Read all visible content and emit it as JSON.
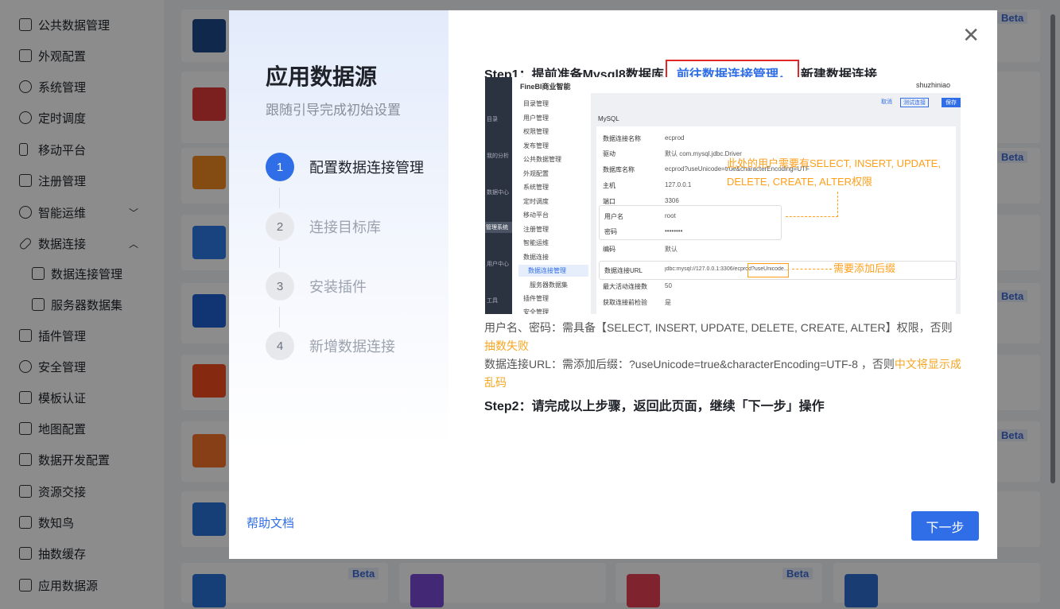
{
  "sidebar": {
    "items": [
      {
        "label": "公共数据管理"
      },
      {
        "label": "外观配置"
      },
      {
        "label": "系统管理"
      },
      {
        "label": "定时调度"
      },
      {
        "label": "移动平台"
      },
      {
        "label": "注册管理"
      },
      {
        "label": "智能运维"
      },
      {
        "label": "数据连接"
      },
      {
        "label": "数据连接管理"
      },
      {
        "label": "服务器数据集"
      },
      {
        "label": "插件管理"
      },
      {
        "label": "安全管理"
      },
      {
        "label": "模板认证"
      },
      {
        "label": "地图配置"
      },
      {
        "label": "数据开发配置"
      },
      {
        "label": "资源交接"
      },
      {
        "label": "数知鸟"
      },
      {
        "label": "抽数缓存"
      },
      {
        "label": "应用数据源"
      }
    ]
  },
  "background": {
    "beta_label": "Beta"
  },
  "modal": {
    "title": "应用数据源",
    "subtitle": "跟随引导完成初始设置",
    "steps": [
      {
        "num": "1",
        "label": "配置数据连接管理"
      },
      {
        "num": "2",
        "label": "连接目标库"
      },
      {
        "num": "3",
        "label": "安装插件"
      },
      {
        "num": "4",
        "label": "新增数据连接"
      }
    ],
    "help_link": "帮助文档",
    "step1_prefix": "Step1：提前准备Mysql8数据库",
    "step1_link": "前往数据连接管理，",
    "step1_suffix": "新建数据连接",
    "screenshot": {
      "app_name": "FineBI商业智能",
      "user": "shuzhiniao",
      "nav": [
        "目录",
        "我的分析",
        "数据中心",
        "管理系统",
        "用户中心",
        "工具"
      ],
      "menu": [
        "目录管理",
        "用户管理",
        "权限管理",
        "发布管理",
        "公共数据管理",
        "外观配置",
        "系统管理",
        "定时调度",
        "移动平台",
        "注册管理",
        "智能运维",
        "数据连接",
        "数据连接管理",
        "服务器数据集",
        "插件管理",
        "安全管理"
      ],
      "buttons": [
        "取消",
        "测试连接",
        "保存"
      ],
      "db_type": "MySQL",
      "fields": [
        {
          "label": "数据连接名称",
          "value": "ecprod"
        },
        {
          "label": "驱动",
          "value": "默认        com.mysql.jdbc.Driver"
        },
        {
          "label": "数据库名称",
          "value": "ecprod?useUnicode=true&characterEncoding=UTF"
        },
        {
          "label": "主机",
          "value": "127.0.0.1"
        },
        {
          "label": "端口",
          "value": "3306"
        },
        {
          "label": "用户名",
          "value": "root"
        },
        {
          "label": "密码",
          "value": "••••••••"
        },
        {
          "label": "编码",
          "value": "默认"
        },
        {
          "label": "数据连接URL",
          "value": "jdbc:mysql://127.0.0.1:3306/ecprod?useUnicode..."
        },
        {
          "label": "最大活动连接数",
          "value": "50"
        },
        {
          "label": "获取连接前检验",
          "value": "是"
        }
      ],
      "annotation_main": "此处的用户需要有SELECT, INSERT, UPDATE, DELETE, CREATE, ALTER权限",
      "annotation_suffix": "需要添加后缀"
    },
    "note_line1": "用户名、密码：需具备【SELECT, INSERT, UPDATE, DELETE, CREATE, ALTER】权限，否则",
    "note_line1_warn": "抽数失败",
    "note_line2": "数据连接URL：需添加后缀：?useUnicode=true&characterEncoding=UTF-8 ，否则",
    "note_line2_warn": "中文将显示成乱码",
    "step2": "Step2：请完成以上步骤，返回此页面，继续「下一步」操作",
    "next_button": "下一步",
    "close_icon": "close-icon"
  },
  "colors": {
    "accent": "#2f6ee6",
    "warn": "#f5a623",
    "highlight_box": "#e02727"
  }
}
